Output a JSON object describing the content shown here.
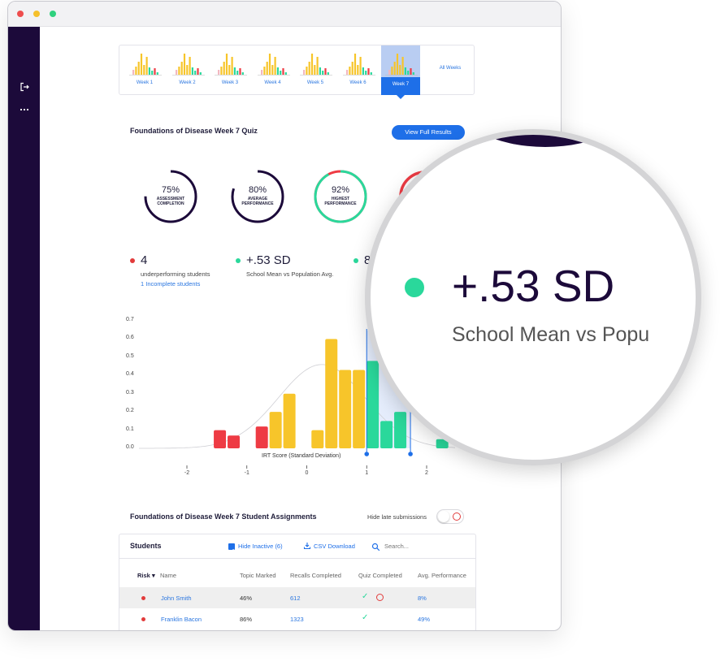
{
  "weeks": [
    "Week 1",
    "Week 2",
    "Week 3",
    "Week 4",
    "Week 5",
    "Week 6",
    "Week 7"
  ],
  "weeks_all": "All Weeks",
  "active_week": "Week 7",
  "quiz": {
    "title": "Foundations of Disease Week 7 Quiz",
    "view_full_results": "View Full Results"
  },
  "gauges": [
    {
      "value": "75%",
      "label": "ASSESSMENT COMPLETION",
      "fraction": 0.75,
      "color": "#1c0a3a"
    },
    {
      "value": "80%",
      "label": "AVERAGE PERFORMANCE",
      "fraction": 0.8,
      "color": "#1c0a3a"
    },
    {
      "value": "92%",
      "label": "HIGHEST PERFORMANCE",
      "fraction": 0.92,
      "color": "#2ad89b"
    }
  ],
  "stats": [
    {
      "value": "4",
      "description": "underperforming students",
      "link": "1 Incomplete students",
      "color": "#e23b3b"
    },
    {
      "value": "+.53 SD",
      "description": "School Mean vs Population Avg.",
      "color": "#2ad89b"
    },
    {
      "value": "8",
      "color": "#2ad89b"
    }
  ],
  "chart_data": {
    "type": "bar",
    "xlabel": "IRT Score (Standard Deviation)",
    "y_ticks": [
      "0.7",
      "0.6",
      "0.5",
      "0.4",
      "0.3",
      "0.2",
      "0.1",
      "0.0"
    ],
    "x_ticks": [
      "-2",
      "-1",
      "0",
      "1",
      "2"
    ],
    "ylim": [
      0,
      0.7
    ],
    "xlim": [
      -2.8,
      2.8
    ],
    "bars": [
      {
        "x": -1.45,
        "value": 0.1,
        "color": "#ee3b44"
      },
      {
        "x": -1.22,
        "value": 0.07,
        "color": "#ee3b44"
      },
      {
        "x": -0.75,
        "value": 0.12,
        "color": "#ee3b44"
      },
      {
        "x": -0.52,
        "value": 0.2,
        "color": "#f7c52a"
      },
      {
        "x": -0.29,
        "value": 0.3,
        "color": "#f7c52a"
      },
      {
        "x": 0.18,
        "value": 0.1,
        "color": "#f7c52a"
      },
      {
        "x": 0.41,
        "value": 0.6,
        "color": "#f7c52a"
      },
      {
        "x": 0.64,
        "value": 0.43,
        "color": "#f7c52a"
      },
      {
        "x": 0.87,
        "value": 0.43,
        "color": "#f7c52a"
      },
      {
        "x": 1.1,
        "value": 0.48,
        "color": "#2ad89b"
      },
      {
        "x": 1.33,
        "value": 0.15,
        "color": "#2ad89b"
      },
      {
        "x": 1.56,
        "value": 0.2,
        "color": "#2ad89b"
      },
      {
        "x": 2.26,
        "value": 0.05,
        "color": "#2ad89b"
      }
    ],
    "markers": [
      1.0,
      1.73
    ]
  },
  "assignments": {
    "title": "Foundations of Disease Week 7 Student Assignments",
    "hide_late": "Hide late submissions"
  },
  "table": {
    "title": "Students",
    "hide_inactive": "Hide Inactive (6)",
    "csv": "CSV Download",
    "search_placeholder": "Search...",
    "headers": [
      "Risk",
      "Name",
      "Topic Marked",
      "Recalls Completed",
      "Quiz Completed",
      "Avg. Performance"
    ],
    "rows": [
      {
        "name": "John Smith",
        "topic": "46%",
        "recalls": "612",
        "avg": "8%"
      },
      {
        "name": "Franklin Bacon",
        "topic": "86%",
        "recalls": "1323",
        "avg": "49%"
      }
    ]
  },
  "magnifier": {
    "value": "+.53 SD",
    "description": "School Mean vs Popu"
  }
}
